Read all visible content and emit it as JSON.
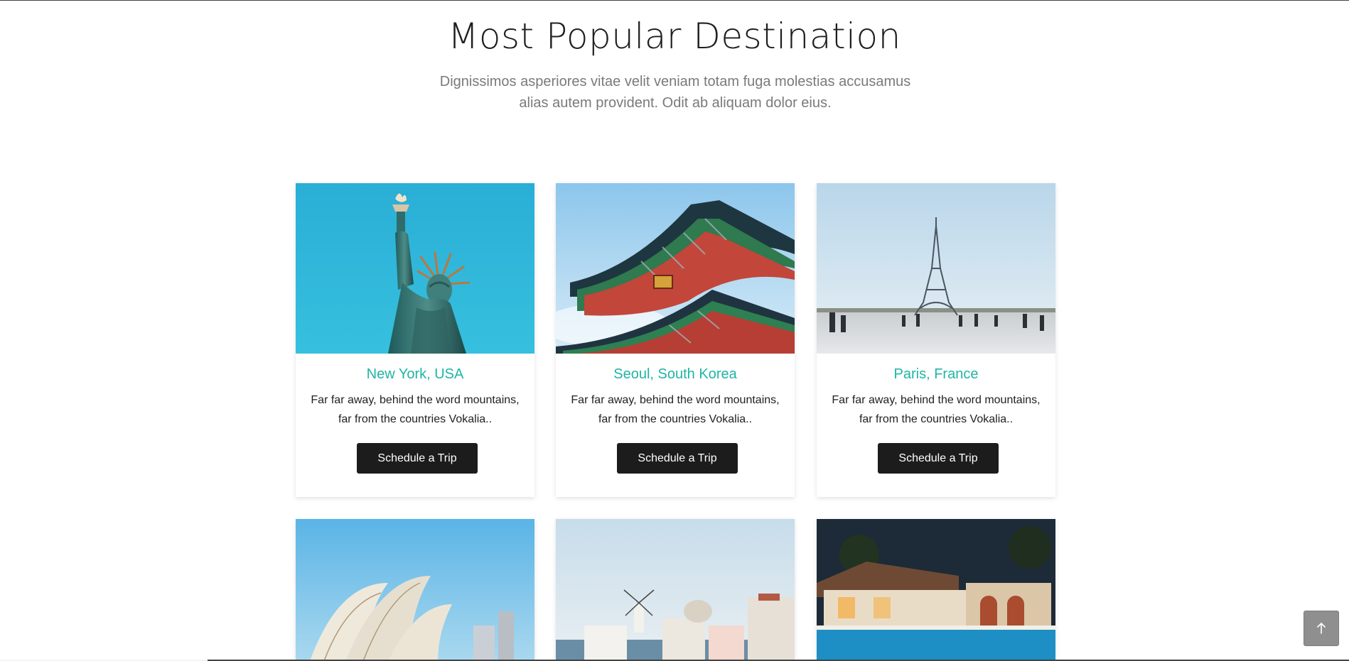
{
  "section": {
    "title": "Most Popular Destination",
    "subtitle": "Dignissimos asperiores vitae velit veniam totam fuga molestias accusamus alias autem provident. Odit ab aliquam dolor eius."
  },
  "destinations": [
    {
      "city": "New York, USA",
      "description": "Far far away, behind the word mountains, far from the countries Vokalia..",
      "button_label": "Schedule a Trip",
      "image": "statue-of-liberty-photo"
    },
    {
      "city": "Seoul, South Korea",
      "description": "Far far away, behind the word mountains, far from the countries Vokalia..",
      "button_label": "Schedule a Trip",
      "image": "korean-palace-roof-photo"
    },
    {
      "city": "Paris, France",
      "description": "Far far away, behind the word mountains, far from the countries Vokalia..",
      "button_label": "Schedule a Trip",
      "image": "eiffel-tower-photo"
    }
  ],
  "more_destinations": [
    {
      "image": "sydney-opera-house-photo"
    },
    {
      "image": "santorini-village-photo"
    },
    {
      "image": "villa-pool-night-photo"
    }
  ],
  "back_to_top": {
    "icon": "arrow-up-icon"
  },
  "colors": {
    "accent": "#1fb5a4",
    "button": "#1c1c1c",
    "heading": "#1f1f1f",
    "subtext": "#7a7a7a"
  }
}
